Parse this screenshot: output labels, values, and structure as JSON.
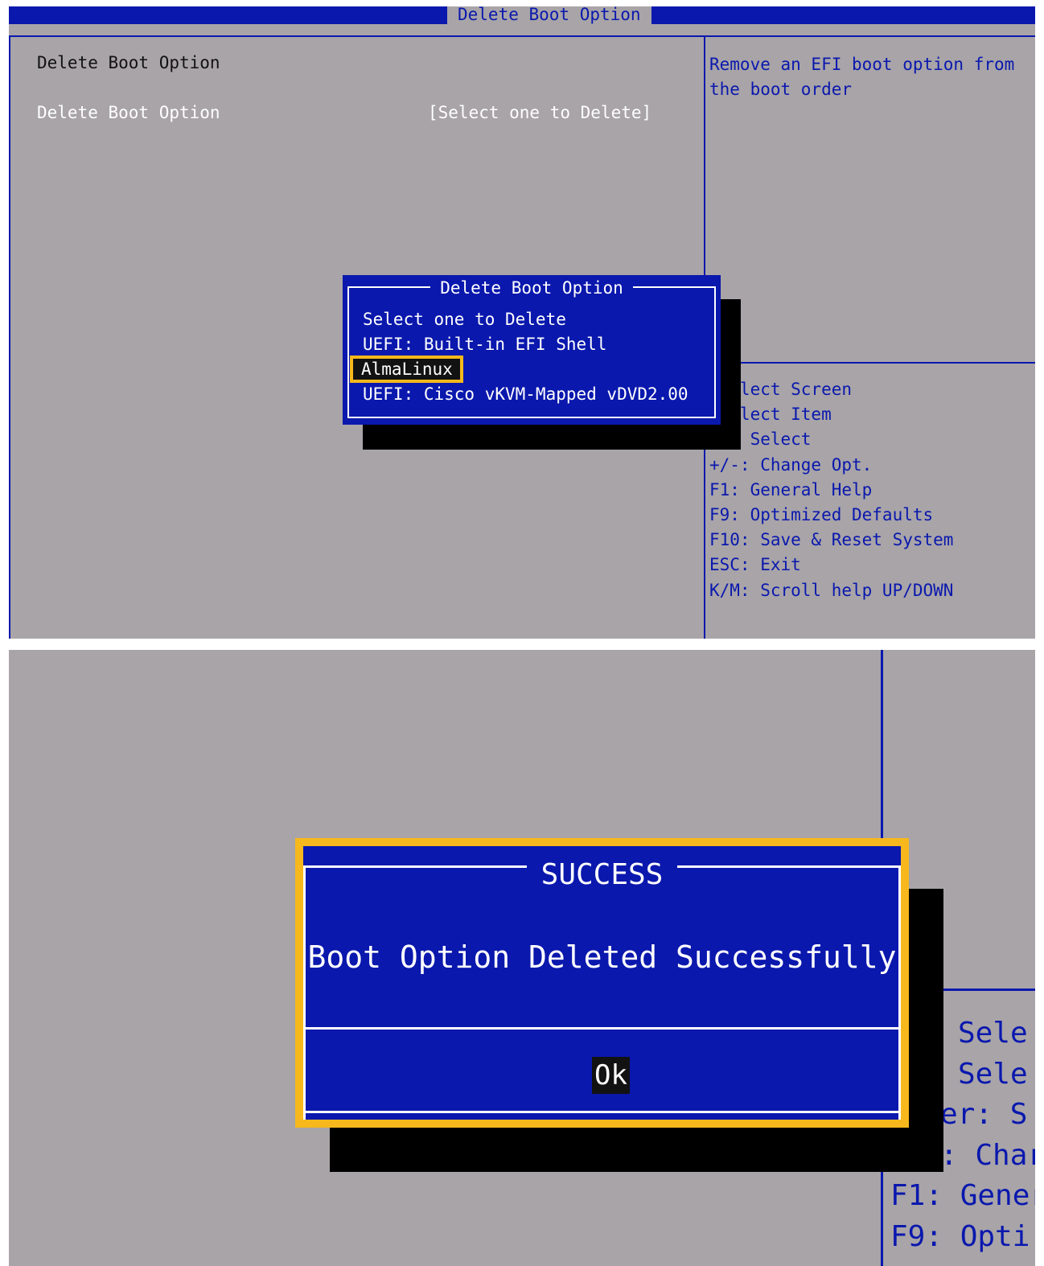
{
  "top_screen": {
    "title": "Delete Boot Option",
    "section_label": "Delete Boot Option",
    "setting": {
      "label": "Delete Boot Option",
      "value": "[Select one to Delete]"
    },
    "help_text": "Remove an EFI boot option from the boot order",
    "key_help": [
      " Select Screen",
      " Select Item",
      "er: Select",
      "+/-: Change Opt.",
      "F1: General Help",
      "F9: Optimized Defaults",
      "F10: Save & Reset System",
      "ESC: Exit",
      "K/M: Scroll help UP/DOWN"
    ],
    "popup": {
      "title": "Delete Boot Option",
      "items": [
        "Select one to Delete",
        "UEFI: Built-in EFI Shell",
        "AlmaLinux",
        "UEFI: Cisco vKVM-Mapped vDVD2.00"
      ],
      "selected_index": 2,
      "highlight_color": "#f6b81c"
    }
  },
  "bottom_screen": {
    "dialog": {
      "title": "SUCCESS",
      "message": "Boot Option Deleted Successfully",
      "ok_label": "Ok",
      "border_color": "#f6b81c"
    },
    "key_help_partial": [
      "Sele",
      "Sele",
      "er: S",
      ": Char",
      "F1: Gener",
      "F9: Opti"
    ]
  },
  "colors": {
    "background": "#a8a4a8",
    "bios_blue": "#0a18ad",
    "text_dark": "#121212",
    "text_light": "#ffffff",
    "highlight": "#f6b81c"
  }
}
